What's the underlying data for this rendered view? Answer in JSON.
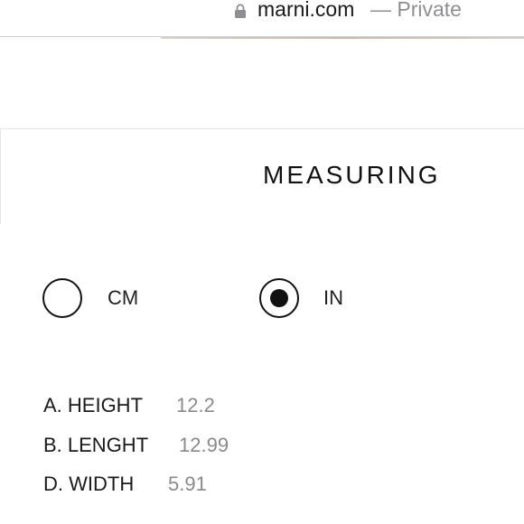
{
  "browser": {
    "domain": "marni.com",
    "suffix": "— Private",
    "lock_icon": "lock-icon"
  },
  "panel": {
    "title": "MEASURING",
    "units": [
      {
        "label": "CM",
        "selected": false
      },
      {
        "label": "IN",
        "selected": true
      }
    ],
    "measurements": [
      {
        "label": "A. HEIGHT",
        "value": "12.2"
      },
      {
        "label": "B. LENGHT",
        "value": "12.99"
      },
      {
        "label": "D. WIDTH",
        "value": "5.91"
      }
    ]
  }
}
